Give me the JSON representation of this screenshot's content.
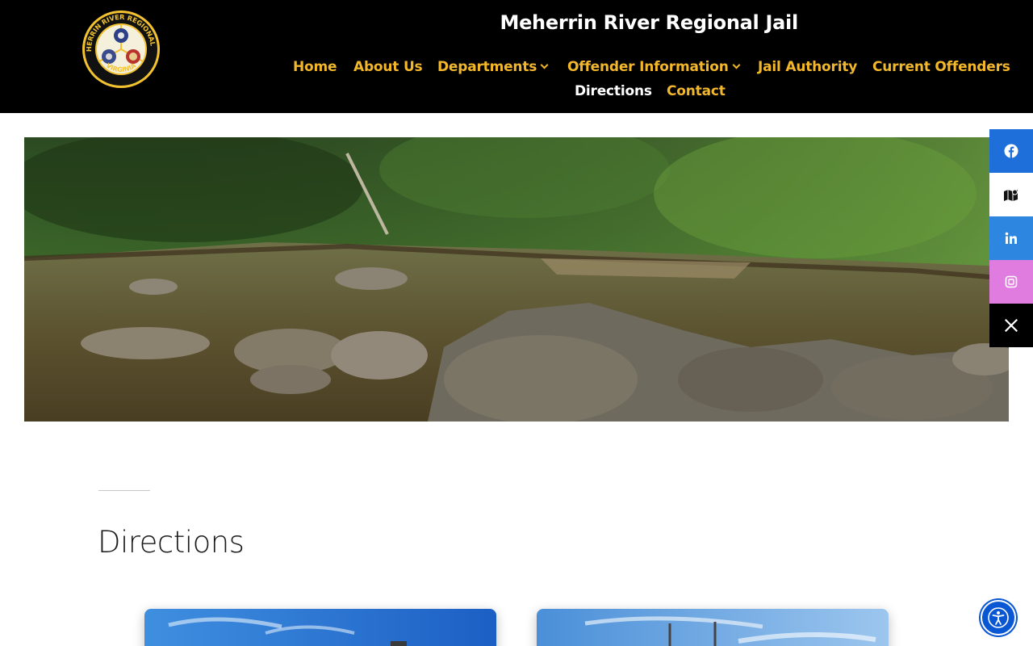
{
  "header": {
    "site_title": "Meherrin River Regional Jail",
    "logo_text_top": "MEHERRIN RIVER REGIONAL JAIL",
    "logo_text_bottom": "VIRGINIA",
    "accent_color": "#f2b72a",
    "background_color": "#000000"
  },
  "nav": {
    "items": [
      {
        "label": "Home",
        "has_dropdown": false,
        "current": false
      },
      {
        "label": "About Us",
        "has_dropdown": false,
        "current": false
      },
      {
        "label": "Departments",
        "has_dropdown": true,
        "current": false
      },
      {
        "label": "Offender Information",
        "has_dropdown": true,
        "current": false
      },
      {
        "label": "Jail Authority",
        "has_dropdown": false,
        "current": false
      },
      {
        "label": "Current Offenders",
        "has_dropdown": false,
        "current": false
      },
      {
        "label": "Directions",
        "has_dropdown": false,
        "current": true
      },
      {
        "label": "Contact",
        "has_dropdown": false,
        "current": false
      }
    ]
  },
  "hero": {
    "icon": "river-photo"
  },
  "social": {
    "items": [
      {
        "icon": "facebook-icon",
        "color": "#1e6fd9"
      },
      {
        "icon": "map-icon",
        "color": "#ffffff"
      },
      {
        "icon": "linkedin-icon",
        "color": "#2d86e0"
      },
      {
        "icon": "instagram-icon",
        "color": "#e07ce0"
      },
      {
        "icon": "x-icon",
        "color": "#000000"
      }
    ]
  },
  "main": {
    "title": "Directions"
  },
  "accessibility": {
    "icon": "accessibility-icon",
    "color": "#0a57d3"
  }
}
